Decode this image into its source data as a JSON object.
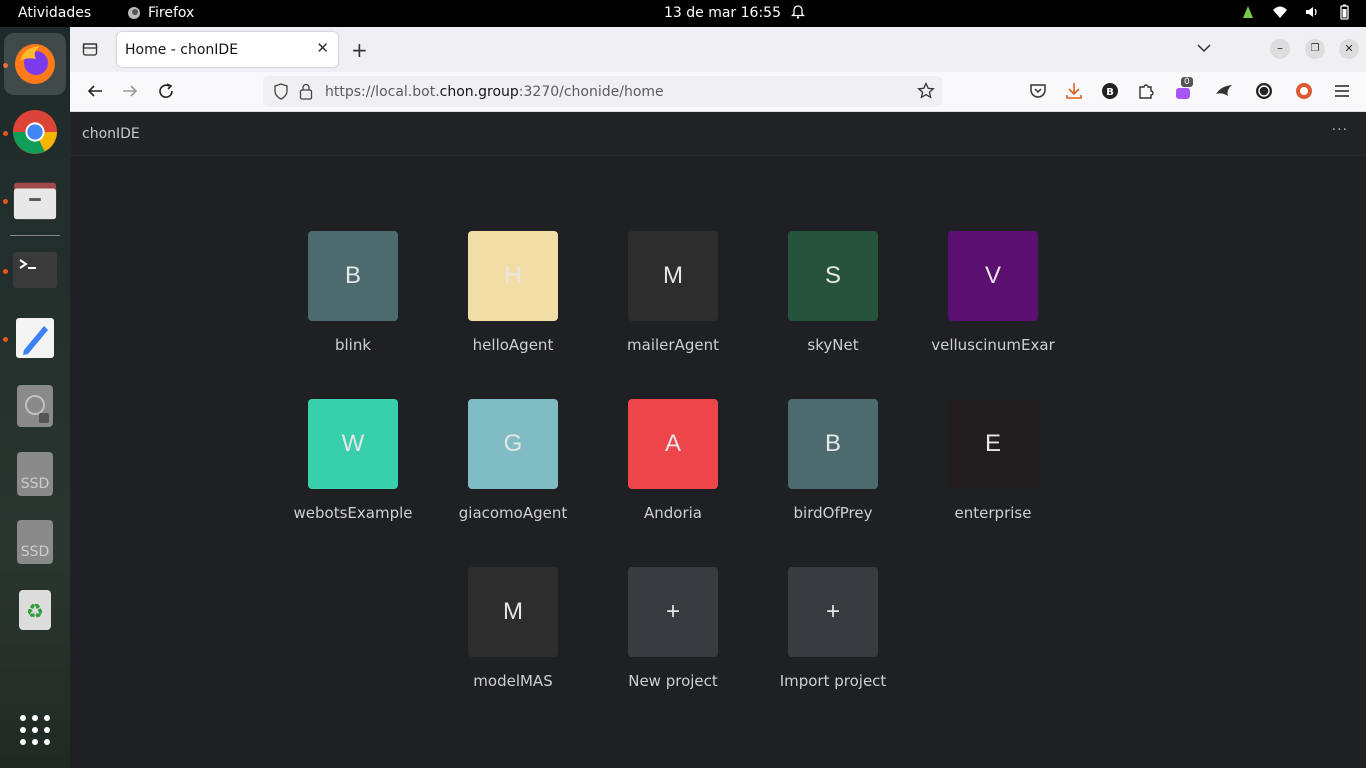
{
  "topbar": {
    "activities": "Atividades",
    "app_name": "Firefox",
    "clock": "13 de mar  16:55"
  },
  "dock": {
    "items": [
      "firefox-icon",
      "chrome-icon",
      "files-icon",
      "terminal-icon",
      "text-editor-icon",
      "disk-icon",
      "ssd-icon",
      "ssd-icon",
      "trash-icon",
      "app-grid-icon"
    ],
    "ssd_label": "SSD"
  },
  "browser": {
    "tab_title": "Home - chonIDE",
    "url_prefix": "https://local.bot.",
    "url_domain": "chon.group",
    "url_suffix": ":3270/chonide/home",
    "extension_badge": "0"
  },
  "app": {
    "title": "chonIDE",
    "menu": "···"
  },
  "projects": [
    {
      "letter": "B",
      "name": "blink",
      "color": "#4d6b6e"
    },
    {
      "letter": "H",
      "name": "helloAgent",
      "color": "#f2dea4"
    },
    {
      "letter": "M",
      "name": "mailerAgent",
      "color": "#2e2d2e"
    },
    {
      "letter": "S",
      "name": "skyNet",
      "color": "#26533a"
    },
    {
      "letter": "V",
      "name": "velluscinumExar",
      "color": "#5b0f70"
    },
    {
      "letter": "W",
      "name": "webotsExample",
      "color": "#38cfac"
    },
    {
      "letter": "G",
      "name": "giacomoAgent",
      "color": "#7fbcc3"
    },
    {
      "letter": "A",
      "name": "Andoria",
      "color": "#ee454a"
    },
    {
      "letter": "B",
      "name": "birdOfPrey",
      "color": "#4d6b6e"
    },
    {
      "letter": "E",
      "name": "enterprise",
      "color": "#221d1e"
    },
    {
      "letter": "M",
      "name": "modelMAS",
      "color": "#2e2d2e"
    },
    {
      "letter": "+",
      "name": "New project",
      "color": "#383c40"
    },
    {
      "letter": "+",
      "name": "Import project",
      "color": "#383c40"
    }
  ]
}
